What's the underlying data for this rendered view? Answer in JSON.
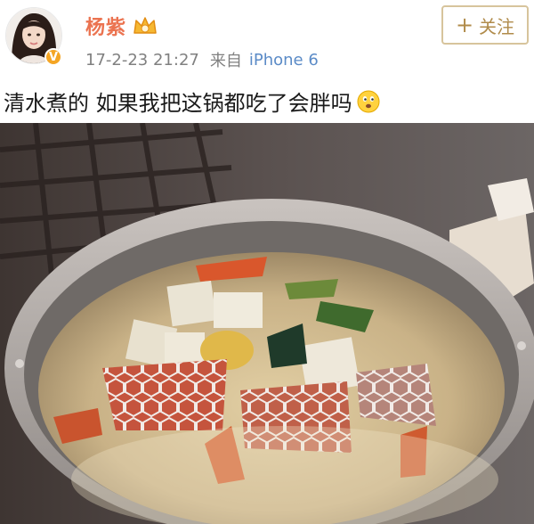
{
  "header": {
    "username": "杨紫",
    "timestamp": "17-2-23 21:27",
    "source_prefix": "来自",
    "device": "iPhone 6",
    "follow_button": {
      "plus": "+",
      "label": "关注"
    },
    "verified_badge": "V"
  },
  "post": {
    "text": "清水煮的 如果我把这锅都吃了会胖吗",
    "emoji": "thinking-face-emoji"
  },
  "colors": {
    "username": "#eb7350",
    "meta": "#808080",
    "device_link": "#5b8bc7",
    "follow_border": "#d7c49c",
    "follow_text": "#b08b4a",
    "verified_badge": "#f4a524"
  },
  "icons": [
    "avatar-photo",
    "verified-badge-icon",
    "vip-crown-icon",
    "thinking-face-emoji"
  ]
}
